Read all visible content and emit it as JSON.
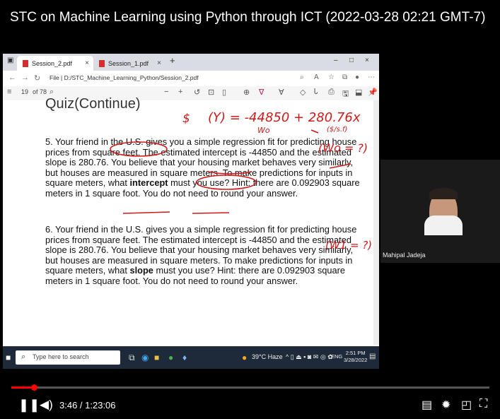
{
  "video": {
    "title": "STC on Machine Learning using Python through ICT (2022-03-28 02:21 GMT-7)"
  },
  "browser": {
    "tabs": [
      {
        "label": "Session_2.pdf",
        "active": true
      },
      {
        "label": "Session_1.pdf",
        "active": false
      }
    ],
    "new_tab": "+",
    "url": "File  |  D:/STC_Machine_Learning_Python/Session_2.pdf"
  },
  "pdf_toolbar": {
    "page_input": "19",
    "page_total": "of 78",
    "zoom_out": "−",
    "zoom_in": "+"
  },
  "document": {
    "heading": "Quiz(Continue)",
    "q5": {
      "a": "5. Your friend in the U.S. gives you a simple regression fit for predicting house prices from square feet. The estimated intercept is -44850 and the estimated slope is 280.76. You believe that your housing market behaves very similarly, but houses are measured in square meters. To make predictions for inputs in square meters, what ",
      "bold": "intercept",
      "b": " must you use? Hint: there are 0.092903 square meters in 1 square foot. You do not need to round your answer."
    },
    "q6": {
      "a": "6. Your friend in the U.S. gives you a simple regression fit for predicting house prices from square feet. The estimated intercept is -44850 and the estimated slope is 280.76. You believe that your housing market behaves very similarly, but houses are measured in square meters. To make predictions for inputs in square meters, what ",
      "bold": "slope",
      "b": " must you use? Hint: there are 0.092903 square meters in 1 square foot. You do not need to round your answer."
    }
  },
  "annotations": {
    "dollar": "$",
    "equation": "(Y) = -44850 + 280.76x",
    "units": "($/s.f)",
    "w0_under": "Wo",
    "w0_q": "(Wo = ?)",
    "w1_q": "(W1 = ?)"
  },
  "taskbar": {
    "search_placeholder": "Type here to search",
    "weather": "39°C Haze",
    "time": "2:51 PM",
    "date": "3/28/2022",
    "lang": "ENG"
  },
  "presenter": {
    "name": "Mahipal Jadeja"
  },
  "player": {
    "time": "3:46 / 1:23:06",
    "progress_percent": 4.8
  },
  "colors": {
    "ink": "#d01a1a",
    "progress": "#ff0000",
    "taskbar": "#1e2a3a"
  }
}
